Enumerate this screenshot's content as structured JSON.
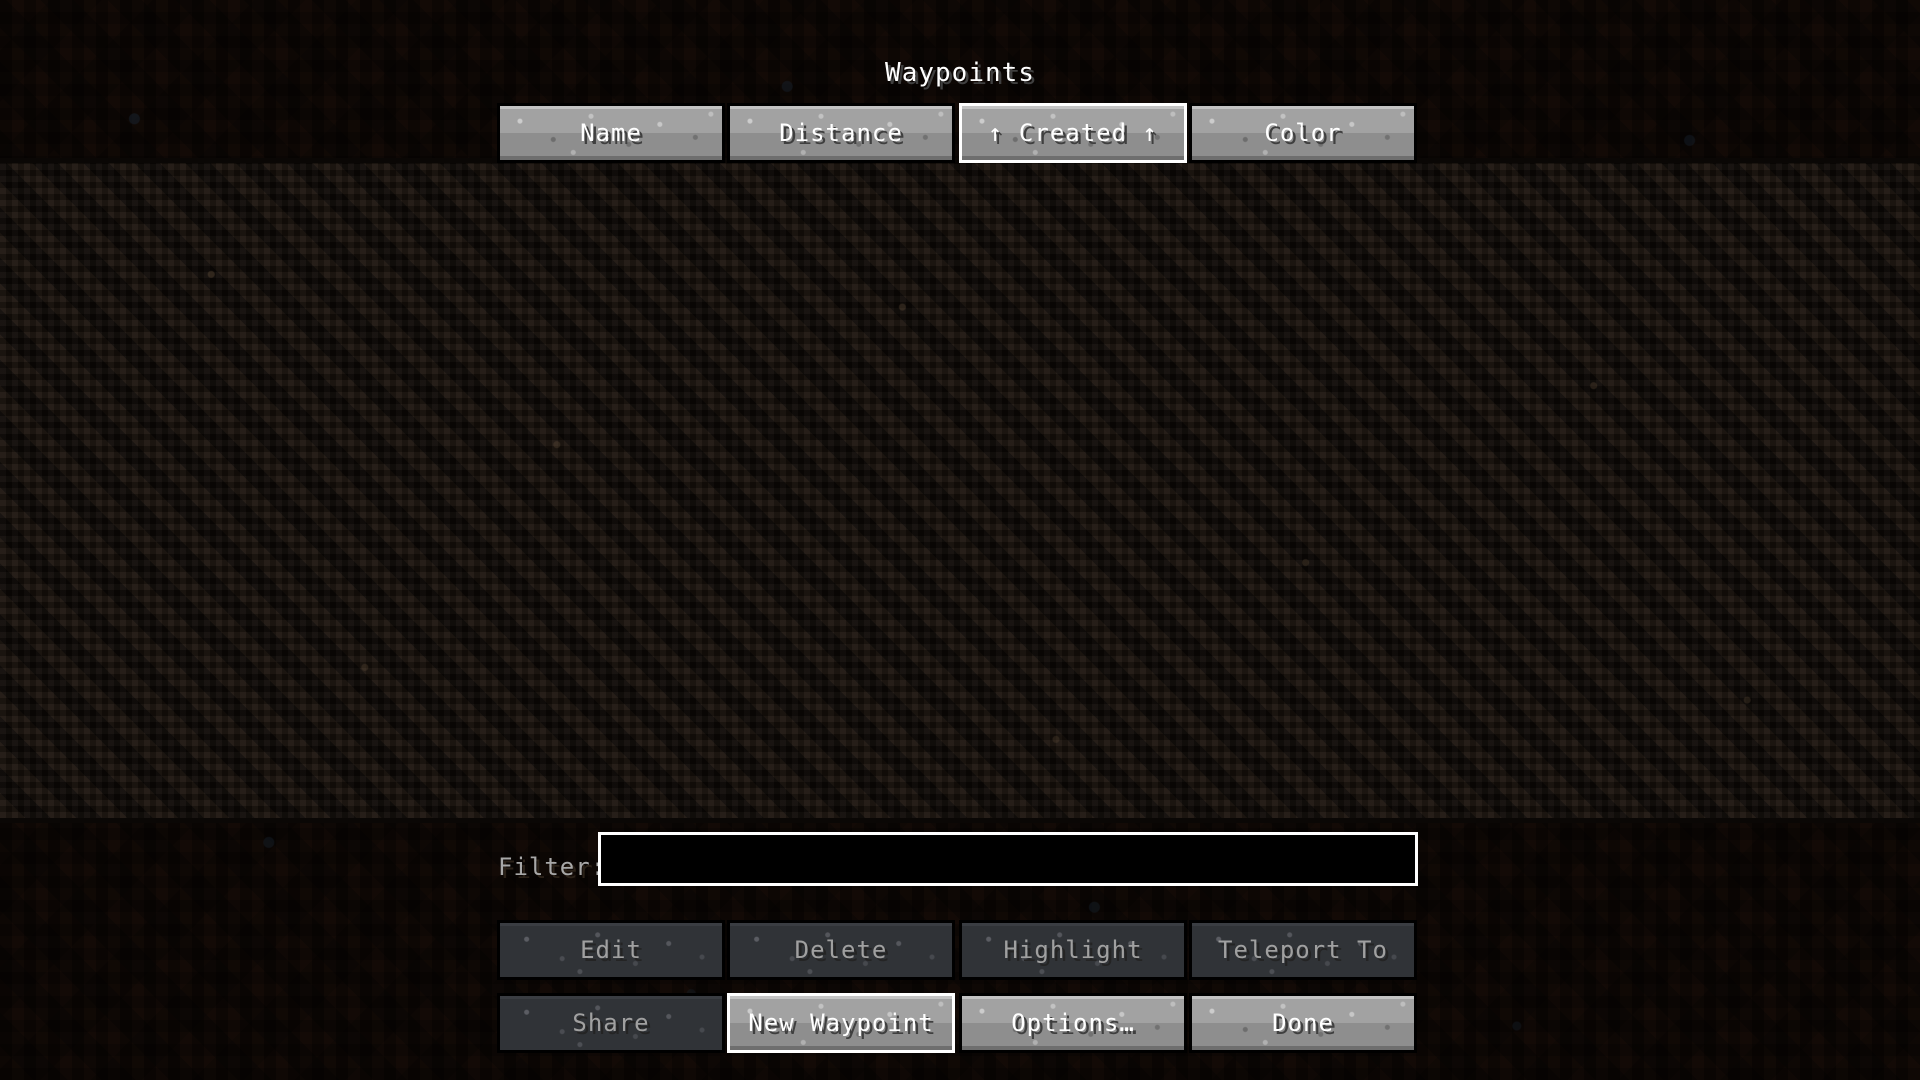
{
  "window": {
    "title": "Waypoints"
  },
  "sort_header": {
    "buttons": [
      {
        "label": "Name",
        "name": "sort-by-name-button",
        "state": "normal"
      },
      {
        "label": "Distance",
        "name": "sort-by-distance-button",
        "state": "normal"
      },
      {
        "label": "↑ Created ↑",
        "name": "sort-by-created-button",
        "state": "focused"
      },
      {
        "label": "Color",
        "name": "sort-by-color-button",
        "state": "normal"
      }
    ]
  },
  "waypoint_list": {
    "items": [],
    "empty": true
  },
  "filter": {
    "label": "Filter:",
    "value": "",
    "placeholder": ""
  },
  "actions": {
    "row1": [
      {
        "label": "Edit",
        "name": "edit-button",
        "state": "disabled"
      },
      {
        "label": "Delete",
        "name": "delete-button",
        "state": "disabled"
      },
      {
        "label": "Highlight",
        "name": "highlight-button",
        "state": "disabled"
      },
      {
        "label": "Teleport To",
        "name": "teleport-to-button",
        "state": "disabled"
      }
    ],
    "row2": [
      {
        "label": "Share",
        "name": "share-button",
        "state": "disabled"
      },
      {
        "label": "New Waypoint",
        "name": "new-waypoint-button",
        "state": "focused"
      },
      {
        "label": "Options…",
        "name": "options-button",
        "state": "normal"
      },
      {
        "label": "Done",
        "name": "done-button",
        "state": "normal"
      }
    ]
  },
  "colors": {
    "button_face": "#9b9b9b",
    "button_disabled": "#2e3034",
    "text_light": "#ffffff",
    "text_disabled": "#a0a0a0",
    "list_background": "#0d0906",
    "dirt_background": "#4a3526"
  }
}
